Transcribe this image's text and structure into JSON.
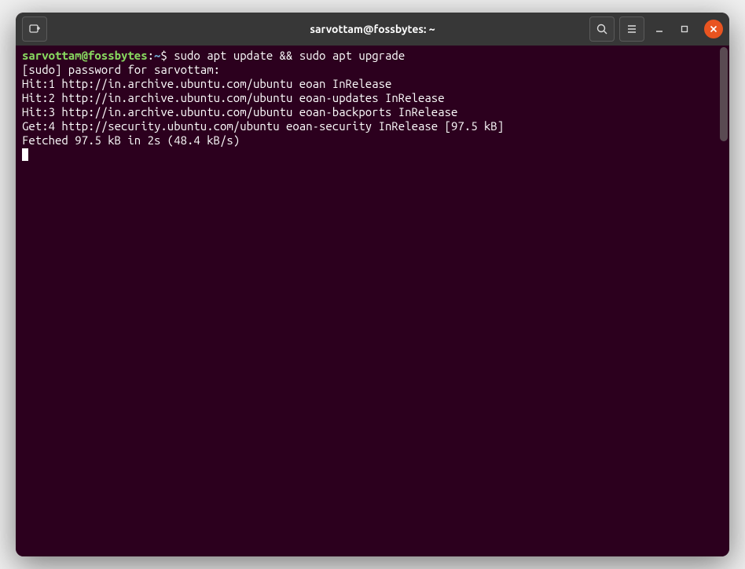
{
  "window": {
    "title": "sarvottam@fossbytes: ~"
  },
  "prompt": {
    "user_host": "sarvottam@fossbytes",
    "separator": ":",
    "path": "~",
    "symbol": "$"
  },
  "command": "sudo apt update && sudo apt upgrade",
  "output_lines": [
    "[sudo] password for sarvottam:",
    "Hit:1 http://in.archive.ubuntu.com/ubuntu eoan InRelease",
    "Hit:2 http://in.archive.ubuntu.com/ubuntu eoan-updates InRelease",
    "Hit:3 http://in.archive.ubuntu.com/ubuntu eoan-backports InRelease",
    "Get:4 http://security.ubuntu.com/ubuntu eoan-security InRelease [97.5 kB]",
    "Fetched 97.5 kB in 2s (48.4 kB/s)"
  ]
}
